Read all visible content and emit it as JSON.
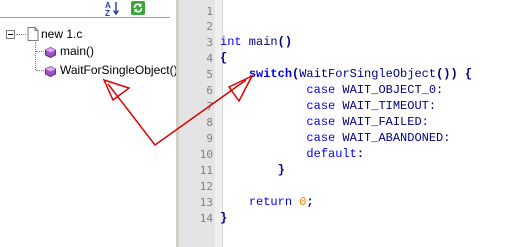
{
  "function_list": {
    "toolbar": {
      "sort_icon": "sort-az-icon",
      "refresh_icon": "refresh-icon"
    },
    "tree": {
      "file": "new 1.c",
      "functions": [
        "main()",
        "WaitForSingleObject()"
      ]
    }
  },
  "editor": {
    "line_numbers": [
      "1",
      "2",
      "3",
      "4",
      "5",
      "6",
      "7",
      "8",
      "9",
      "10",
      "11",
      "12",
      "13",
      "14"
    ],
    "lines": {
      "l3": {
        "kw": "int",
        "name": " main",
        "paren": "()"
      },
      "l4": "{",
      "l5": {
        "indent": "    ",
        "kw": "switch",
        "open": "(",
        "call": "WaitForSingleObject",
        "close": "()) {"
      },
      "l6": {
        "indent": "            ",
        "kw": "case",
        "label": " WAIT_OBJECT_0:"
      },
      "l7": {
        "indent": "            ",
        "kw": "case",
        "label": " WAIT_TIMEOUT:"
      },
      "l8": {
        "indent": "            ",
        "kw": "case",
        "label": " WAIT_FAILED:"
      },
      "l9": {
        "indent": "            ",
        "kw": "case",
        "label": " WAIT_ABANDONED:"
      },
      "l10": {
        "indent": "            ",
        "kw": "default",
        "label": ":"
      },
      "l11": {
        "indent": "        ",
        "text": "}"
      },
      "l13": {
        "indent": "    ",
        "kw": "return",
        "num": " 0",
        "semi": ";"
      },
      "l14": "}"
    }
  },
  "colors": {
    "keyword": "#0000ff",
    "number": "#ff8000",
    "annotation_arrow": "#e00000",
    "gutter": "#e4e4e4"
  }
}
